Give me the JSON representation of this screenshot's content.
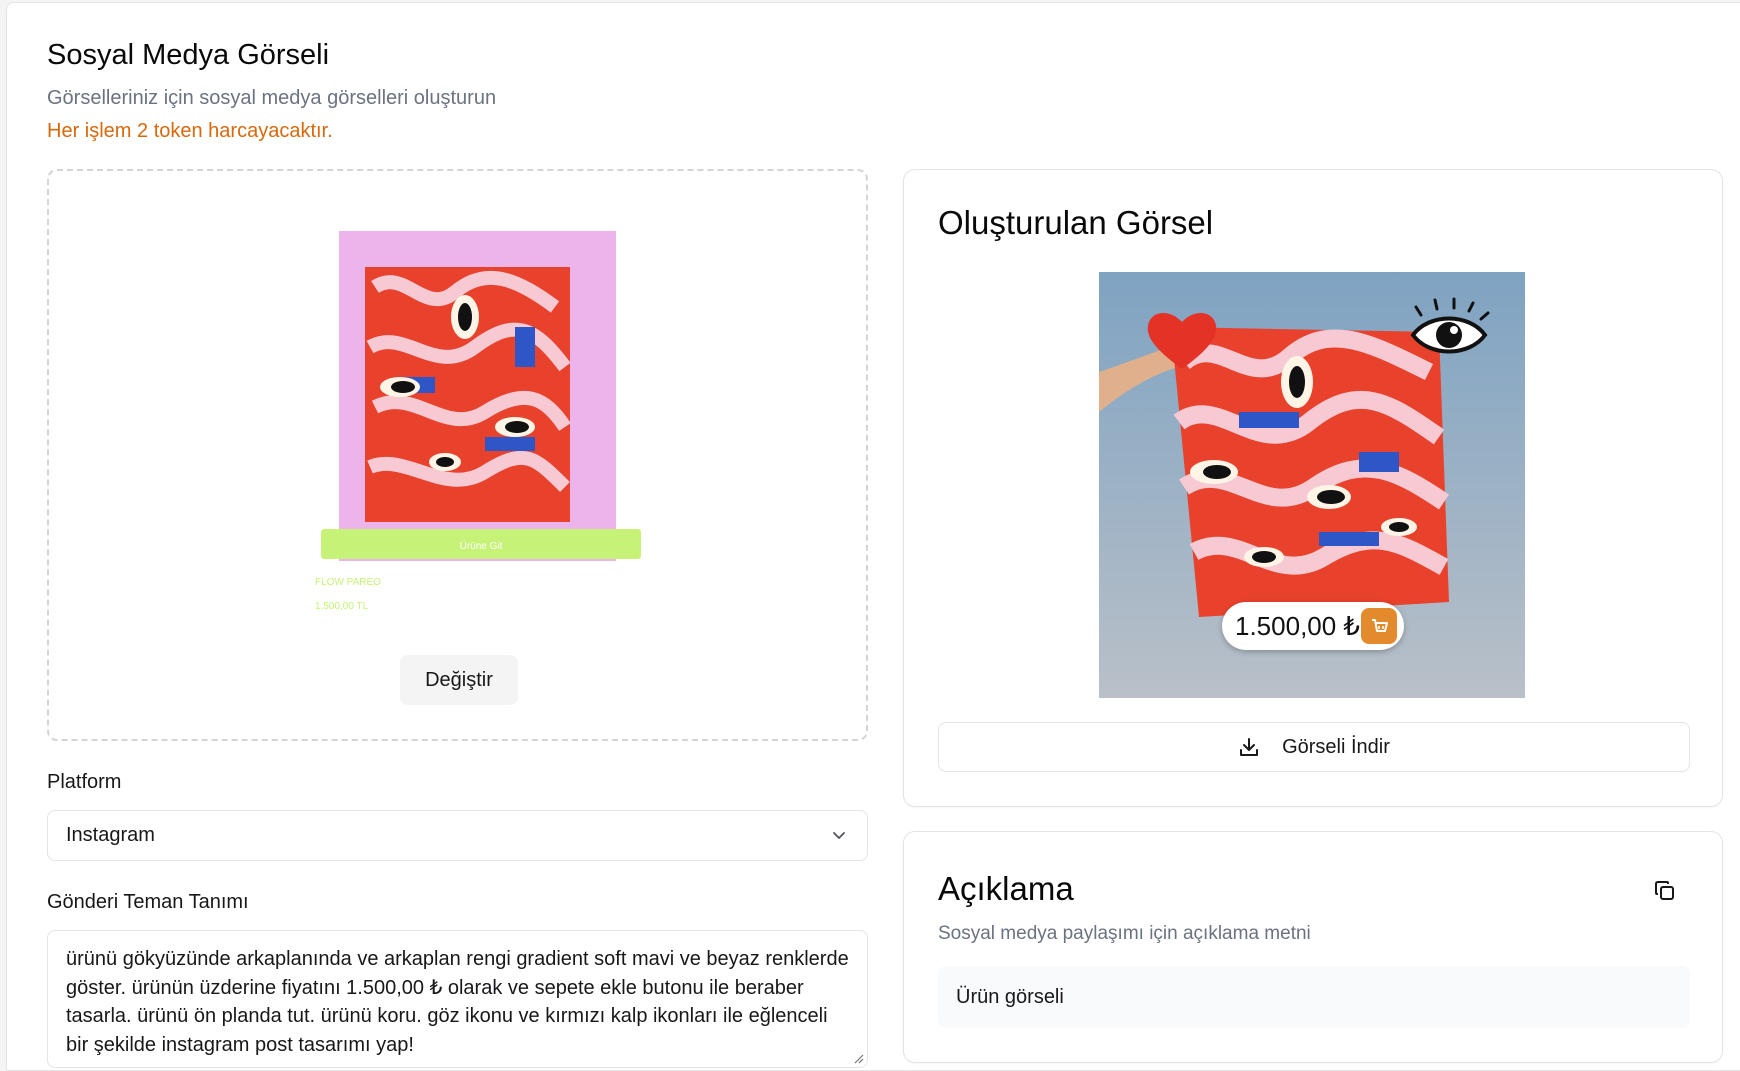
{
  "header": {
    "title": "Sosyal Medya Görseli",
    "subtitle": "Görselleriniz için sosyal medya görselleri oluşturun",
    "token_note": "Her işlem 2 token harcayacaktır."
  },
  "upload": {
    "preview_button_text": "Ürüne Git",
    "preview_product_name": "FLOW PAREO",
    "preview_product_price": "1.500,00 TL",
    "change_label": "Değiştir"
  },
  "form": {
    "platform_label": "Platform",
    "platform_value": "Instagram",
    "theme_label": "Gönderi Teman Tanımı",
    "theme_value": "ürünü gökyüzünde arkaplanında ve arkaplan rengi gradient soft mavi ve beyaz renklerde göster. ürünün üzderine fiyatını 1.500,00 ₺ olarak ve sepete ekle butonu ile beraber tasarla. ürünü ön planda tut. ürünü koru. göz ikonu ve kırmızı kalp ikonları ile eğlenceli bir şekilde instagram post tasarımı yap!"
  },
  "result": {
    "title": "Oluşturulan Görsel",
    "price_badge": "1.500,00 ₺",
    "download_label": "Görseli İndir"
  },
  "description": {
    "title": "Açıklama",
    "subtitle": "Sosyal medya paylaşımı için açıklama metni",
    "text": "Ürün görseli"
  },
  "colors": {
    "accent_orange": "#d9680c",
    "preview_pink": "#ecb4ea",
    "preview_green_button": "#c5f277",
    "scarf_red": "#e8412c",
    "sky_top": "#7fa3c2",
    "sky_bottom": "#b9c0c8"
  }
}
